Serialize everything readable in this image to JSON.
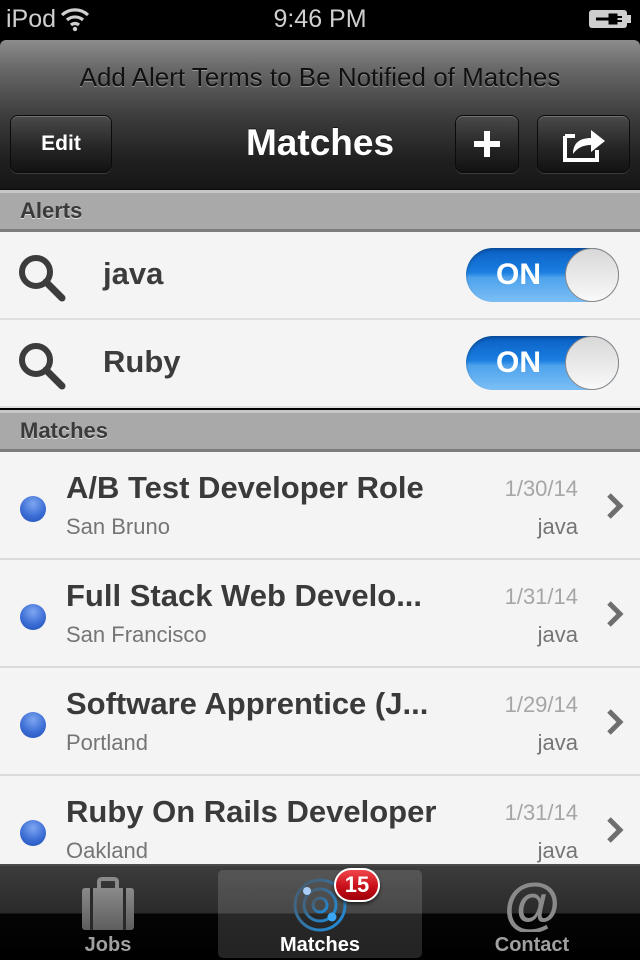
{
  "status_bar": {
    "carrier": "iPod",
    "wifi_icon": "wifi-icon",
    "time": "9:46 PM",
    "battery_icon": "battery-charging-icon"
  },
  "header": {
    "prompt": "Add Alert Terms to Be Notified of Matches",
    "title": "Matches",
    "edit_label": "Edit",
    "add_icon": "plus-icon",
    "share_icon": "share-icon"
  },
  "alerts": {
    "section_label": "Alerts",
    "items": [
      {
        "term": "java",
        "toggle_label": "ON",
        "enabled": true
      },
      {
        "term": "Ruby",
        "toggle_label": "ON",
        "enabled": true
      }
    ]
  },
  "matches": {
    "section_label": "Matches",
    "items": [
      {
        "title": "A/B Test Developer Role",
        "date": "1/30/14",
        "location": "San Bruno",
        "term": "java",
        "unread": true
      },
      {
        "title": "Full Stack Web Develo...",
        "date": "1/31/14",
        "location": "San Francisco",
        "term": "java",
        "unread": true
      },
      {
        "title": "Software Apprentice (J...",
        "date": "1/29/14",
        "location": "Portland",
        "term": "java",
        "unread": true
      },
      {
        "title": "Ruby On Rails Developer",
        "date": "1/31/14",
        "location": "Oakland",
        "term": "java",
        "unread": true
      }
    ]
  },
  "tab_bar": {
    "tabs": [
      {
        "label": "Jobs",
        "icon": "briefcase-icon",
        "active": false
      },
      {
        "label": "Matches",
        "icon": "radar-icon",
        "active": true,
        "badge": "15"
      },
      {
        "label": "Contact",
        "icon": "at-sign-icon",
        "active": false
      }
    ]
  },
  "colors": {
    "toggle_on": "#1a7ee0",
    "unread_dot": "#3d6ed6",
    "badge": "#c8101a"
  }
}
